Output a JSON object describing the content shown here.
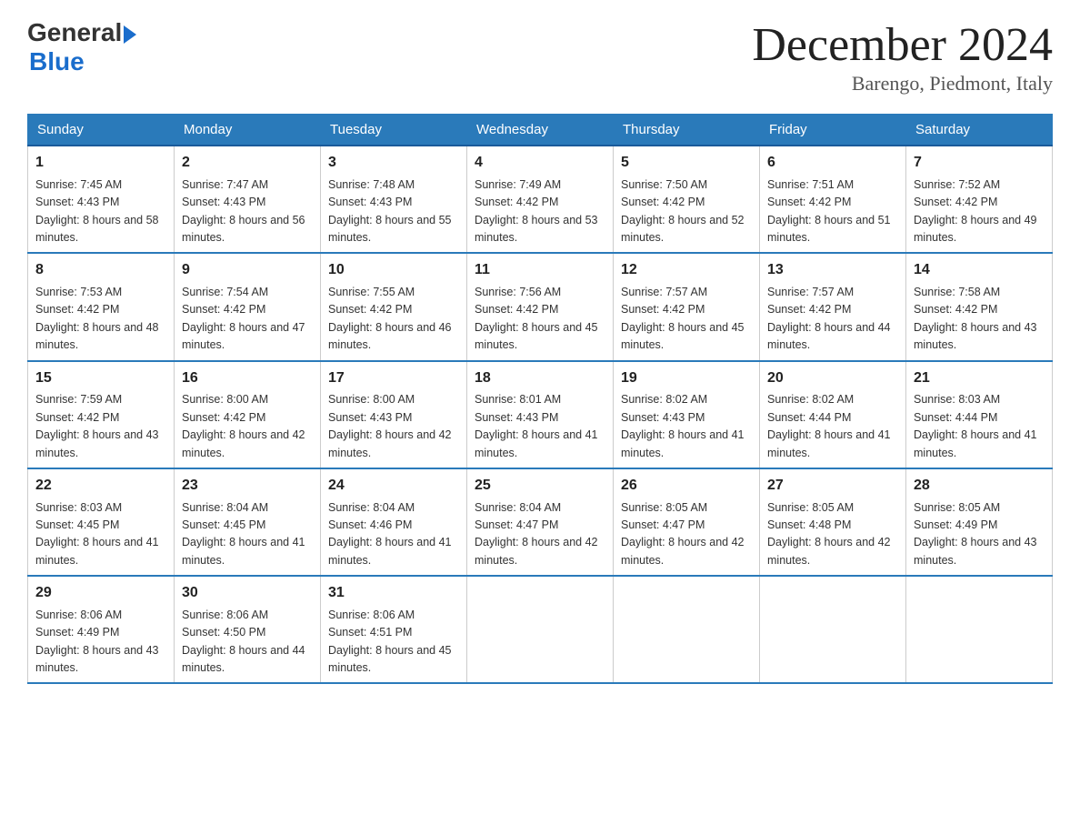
{
  "header": {
    "logo_general": "General",
    "logo_blue": "Blue",
    "month_title": "December 2024",
    "location": "Barengo, Piedmont, Italy"
  },
  "days_of_week": [
    "Sunday",
    "Monday",
    "Tuesday",
    "Wednesday",
    "Thursday",
    "Friday",
    "Saturday"
  ],
  "weeks": [
    [
      {
        "day": "1",
        "sunrise": "7:45 AM",
        "sunset": "4:43 PM",
        "daylight": "8 hours and 58 minutes."
      },
      {
        "day": "2",
        "sunrise": "7:47 AM",
        "sunset": "4:43 PM",
        "daylight": "8 hours and 56 minutes."
      },
      {
        "day": "3",
        "sunrise": "7:48 AM",
        "sunset": "4:43 PM",
        "daylight": "8 hours and 55 minutes."
      },
      {
        "day": "4",
        "sunrise": "7:49 AM",
        "sunset": "4:42 PM",
        "daylight": "8 hours and 53 minutes."
      },
      {
        "day": "5",
        "sunrise": "7:50 AM",
        "sunset": "4:42 PM",
        "daylight": "8 hours and 52 minutes."
      },
      {
        "day": "6",
        "sunrise": "7:51 AM",
        "sunset": "4:42 PM",
        "daylight": "8 hours and 51 minutes."
      },
      {
        "day": "7",
        "sunrise": "7:52 AM",
        "sunset": "4:42 PM",
        "daylight": "8 hours and 49 minutes."
      }
    ],
    [
      {
        "day": "8",
        "sunrise": "7:53 AM",
        "sunset": "4:42 PM",
        "daylight": "8 hours and 48 minutes."
      },
      {
        "day": "9",
        "sunrise": "7:54 AM",
        "sunset": "4:42 PM",
        "daylight": "8 hours and 47 minutes."
      },
      {
        "day": "10",
        "sunrise": "7:55 AM",
        "sunset": "4:42 PM",
        "daylight": "8 hours and 46 minutes."
      },
      {
        "day": "11",
        "sunrise": "7:56 AM",
        "sunset": "4:42 PM",
        "daylight": "8 hours and 45 minutes."
      },
      {
        "day": "12",
        "sunrise": "7:57 AM",
        "sunset": "4:42 PM",
        "daylight": "8 hours and 45 minutes."
      },
      {
        "day": "13",
        "sunrise": "7:57 AM",
        "sunset": "4:42 PM",
        "daylight": "8 hours and 44 minutes."
      },
      {
        "day": "14",
        "sunrise": "7:58 AM",
        "sunset": "4:42 PM",
        "daylight": "8 hours and 43 minutes."
      }
    ],
    [
      {
        "day": "15",
        "sunrise": "7:59 AM",
        "sunset": "4:42 PM",
        "daylight": "8 hours and 43 minutes."
      },
      {
        "day": "16",
        "sunrise": "8:00 AM",
        "sunset": "4:42 PM",
        "daylight": "8 hours and 42 minutes."
      },
      {
        "day": "17",
        "sunrise": "8:00 AM",
        "sunset": "4:43 PM",
        "daylight": "8 hours and 42 minutes."
      },
      {
        "day": "18",
        "sunrise": "8:01 AM",
        "sunset": "4:43 PM",
        "daylight": "8 hours and 41 minutes."
      },
      {
        "day": "19",
        "sunrise": "8:02 AM",
        "sunset": "4:43 PM",
        "daylight": "8 hours and 41 minutes."
      },
      {
        "day": "20",
        "sunrise": "8:02 AM",
        "sunset": "4:44 PM",
        "daylight": "8 hours and 41 minutes."
      },
      {
        "day": "21",
        "sunrise": "8:03 AM",
        "sunset": "4:44 PM",
        "daylight": "8 hours and 41 minutes."
      }
    ],
    [
      {
        "day": "22",
        "sunrise": "8:03 AM",
        "sunset": "4:45 PM",
        "daylight": "8 hours and 41 minutes."
      },
      {
        "day": "23",
        "sunrise": "8:04 AM",
        "sunset": "4:45 PM",
        "daylight": "8 hours and 41 minutes."
      },
      {
        "day": "24",
        "sunrise": "8:04 AM",
        "sunset": "4:46 PM",
        "daylight": "8 hours and 41 minutes."
      },
      {
        "day": "25",
        "sunrise": "8:04 AM",
        "sunset": "4:47 PM",
        "daylight": "8 hours and 42 minutes."
      },
      {
        "day": "26",
        "sunrise": "8:05 AM",
        "sunset": "4:47 PM",
        "daylight": "8 hours and 42 minutes."
      },
      {
        "day": "27",
        "sunrise": "8:05 AM",
        "sunset": "4:48 PM",
        "daylight": "8 hours and 42 minutes."
      },
      {
        "day": "28",
        "sunrise": "8:05 AM",
        "sunset": "4:49 PM",
        "daylight": "8 hours and 43 minutes."
      }
    ],
    [
      {
        "day": "29",
        "sunrise": "8:06 AM",
        "sunset": "4:49 PM",
        "daylight": "8 hours and 43 minutes."
      },
      {
        "day": "30",
        "sunrise": "8:06 AM",
        "sunset": "4:50 PM",
        "daylight": "8 hours and 44 minutes."
      },
      {
        "day": "31",
        "sunrise": "8:06 AM",
        "sunset": "4:51 PM",
        "daylight": "8 hours and 45 minutes."
      },
      null,
      null,
      null,
      null
    ]
  ]
}
